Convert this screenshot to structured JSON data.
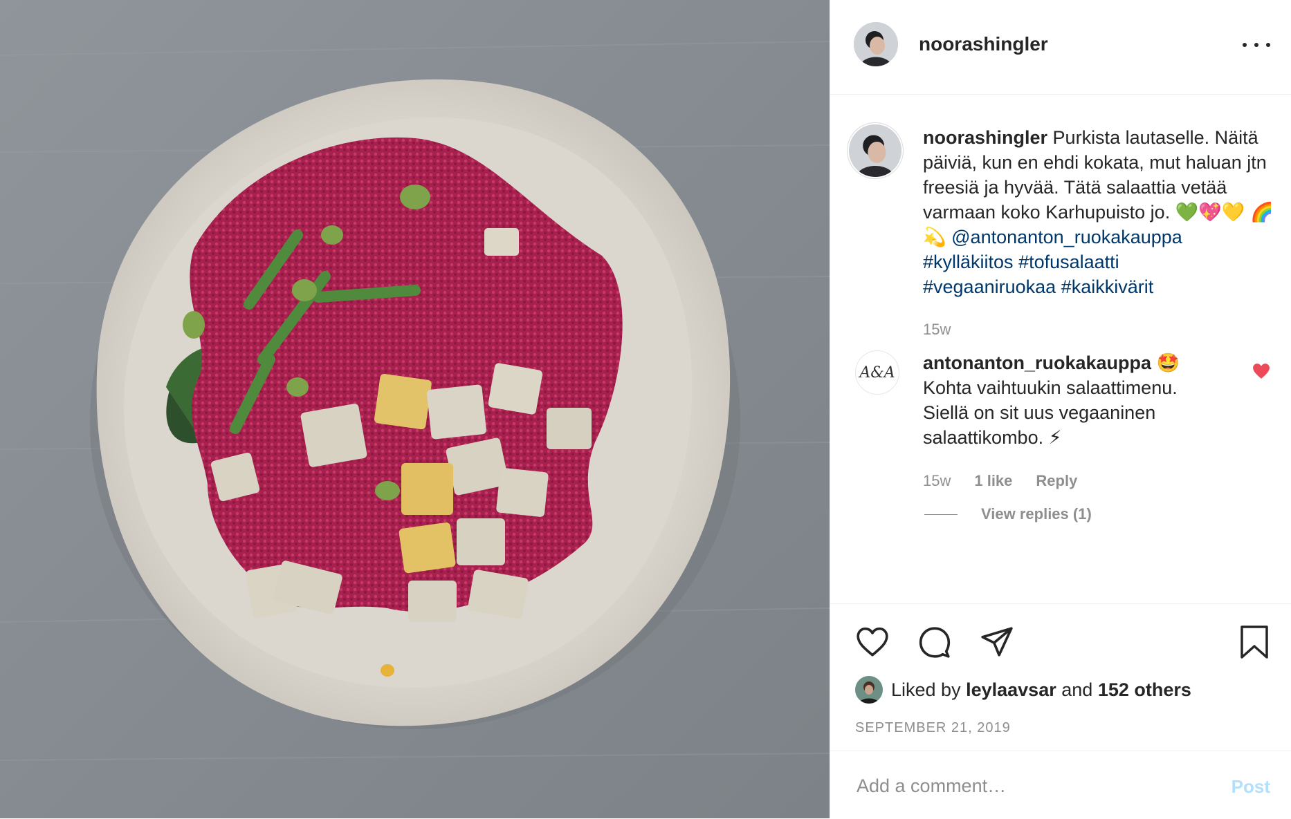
{
  "post": {
    "username": "noorashingler",
    "caption_text": "Purkista lautaselle. Näitä päiviä, kun en ehdi kokata, mut haluan jtn freesiä ja hyvää. Tätä salaattia vetää varmaan koko Karhupuisto jo. 💚💖💛 🌈💫",
    "mention": "@antonanton_ruokakauppa",
    "hashtags": [
      "#kylläkiitos",
      "#tofusalaatti",
      "#vegaaniruokaa",
      "#kaikkivärit"
    ],
    "caption_time": "15w"
  },
  "comment": {
    "avatar_text": "A&A",
    "username": "antonanton_ruokakauppa",
    "username_emoji": "🤩",
    "text": "Kohta vaihtuukin salaattimenu. Siellä on sit uus vegaaninen salaattikombo. ⚡",
    "time": "15w",
    "likes": "1 like",
    "reply_label": "Reply",
    "view_replies": "View replies (1)",
    "liked": true
  },
  "likes": {
    "prefix": "Liked by",
    "user": "leylaavsar",
    "and": "and",
    "others": "152 others"
  },
  "date": "SEPTEMBER 21, 2019",
  "add_comment": {
    "placeholder": "Add a comment…",
    "post_label": "Post"
  },
  "colors": {
    "link": "#00376b",
    "heart": "#ed4956",
    "muted": "#8e8e8e",
    "post_disabled": "#b2dffc"
  }
}
